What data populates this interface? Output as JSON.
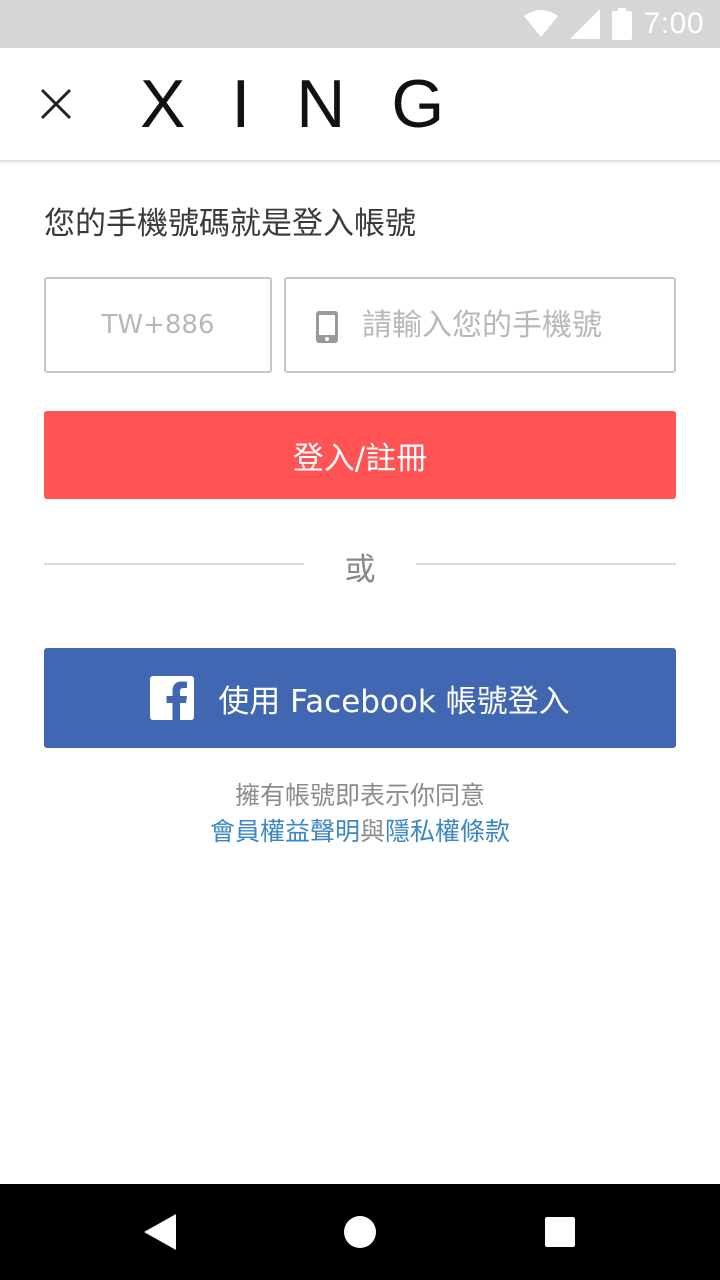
{
  "status_bar": {
    "time": "7:00",
    "icons": [
      "wifi-icon",
      "signal-icon",
      "battery-icon"
    ]
  },
  "header": {
    "close_icon": "close-icon",
    "logo_text": "XING"
  },
  "form": {
    "prompt": "您的手機號碼就是登入帳號",
    "country_code_placeholder": "TW+886",
    "phone_placeholder": "請輸入您的手機號",
    "phone_icon": "mobile-phone-icon",
    "login_button_label": "登入/註冊"
  },
  "divider": {
    "text": "或"
  },
  "facebook": {
    "icon": "facebook-icon",
    "button_label": "使用 Facebook 帳號登入"
  },
  "terms": {
    "intro": "擁有帳號即表示你同意",
    "member_rights_link": "會員權益聲明",
    "conjunction": "與",
    "privacy_link": "隱私權條款"
  },
  "navigation": {
    "back_icon": "back-triangle-icon",
    "home_icon": "home-circle-icon",
    "recents_icon": "recents-square-icon"
  },
  "colors": {
    "primary_red": "#ff5354",
    "facebook_blue": "#4267b2",
    "link_blue": "#3b86c4",
    "status_bar_gray": "#d6d6d6"
  }
}
